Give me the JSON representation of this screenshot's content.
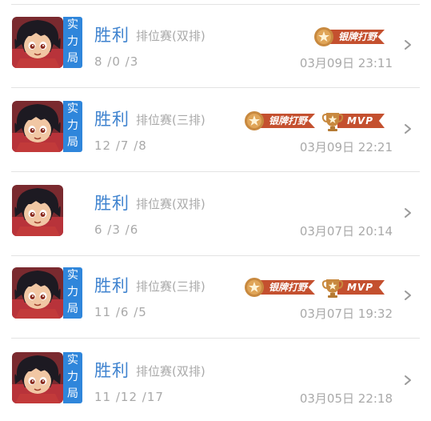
{
  "colors": {
    "result_blue": "#3f83cf",
    "tag_blue": "#2f86db",
    "muted_text": "#a9a9a9",
    "ribbon_red": "#c4502f",
    "medal_bronze": "#c8893f"
  },
  "matches": [
    {
      "mode_tag": [
        "实",
        "力",
        "局"
      ],
      "result": "胜利",
      "match_type": "排位赛(双排)",
      "kda": "8 /0 /3",
      "time": "03月09日 23:11",
      "badges": [
        {
          "icon": "medal-star-icon",
          "label": "银牌打野"
        }
      ]
    },
    {
      "mode_tag": [
        "实",
        "力",
        "局"
      ],
      "result": "胜利",
      "match_type": "排位赛(三排)",
      "kda": "12 /7 /8",
      "time": "03月09日 22:21",
      "badges": [
        {
          "icon": "medal-star-icon",
          "label": "银牌打野"
        },
        {
          "icon": "trophy-star-icon",
          "label": "MVP"
        }
      ]
    },
    {
      "mode_tag": [],
      "result": "胜利",
      "match_type": "排位赛(双排)",
      "kda": "6 /3 /6",
      "time": "03月07日 20:14",
      "badges": []
    },
    {
      "mode_tag": [
        "实",
        "力",
        "局"
      ],
      "result": "胜利",
      "match_type": "排位赛(三排)",
      "kda": "11 /6 /5",
      "time": "03月07日 19:32",
      "badges": [
        {
          "icon": "medal-star-icon",
          "label": "银牌打野"
        },
        {
          "icon": "trophy-star-icon",
          "label": "MVP"
        }
      ]
    },
    {
      "mode_tag": [
        "实",
        "力",
        "局"
      ],
      "result": "胜利",
      "match_type": "排位赛(双排)",
      "kda": "11 /12 /17",
      "time": "03月05日 22:18",
      "badges": []
    }
  ]
}
